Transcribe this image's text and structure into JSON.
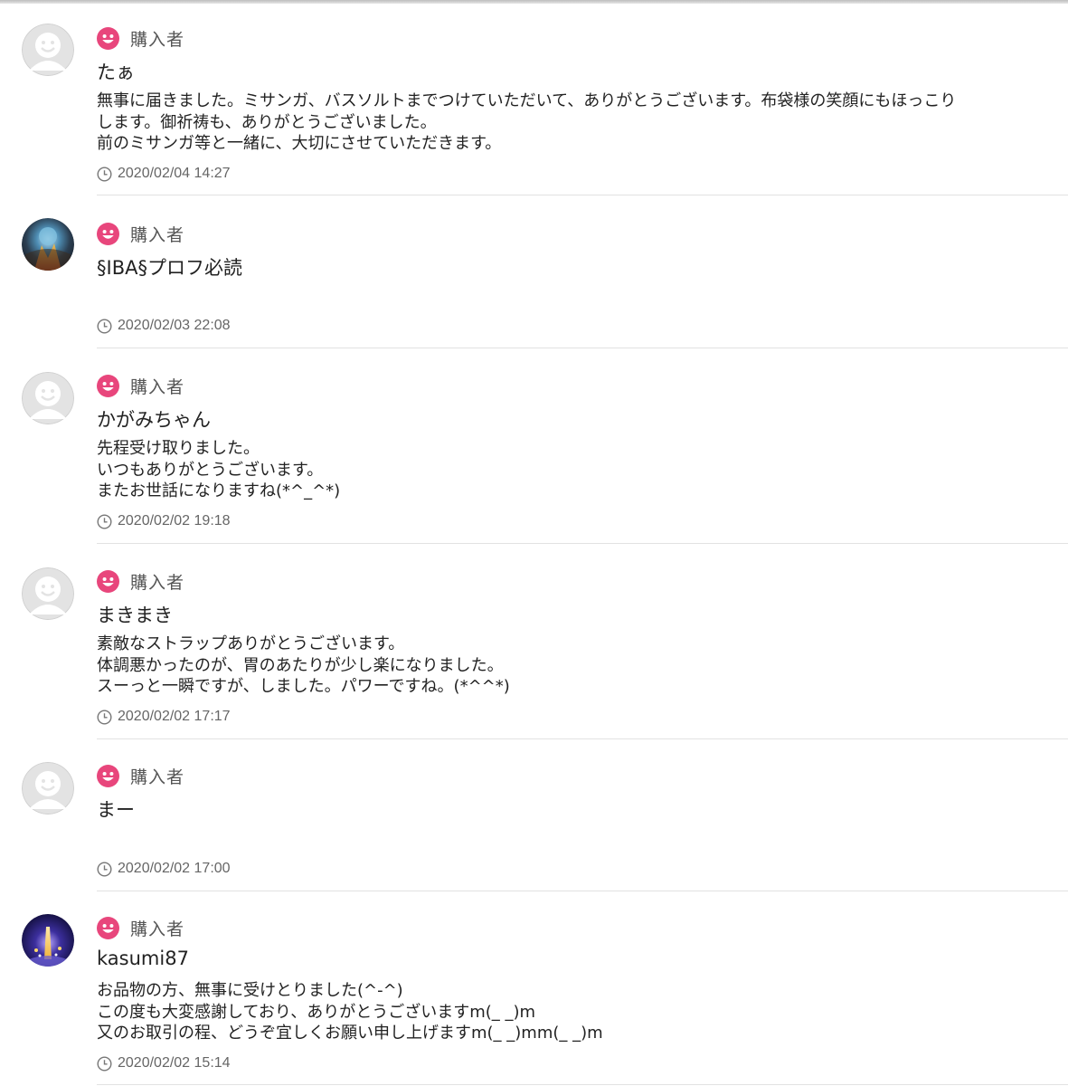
{
  "reviews": [
    {
      "role": "購入者",
      "username": "たぁ",
      "avatar": "default-avatar",
      "comment_lines": [
        "無事に届きました。ミサンガ、バスソルトまでつけていただいて、ありがとうございます。布袋様の笑顔にもほっこり",
        "します。御祈祷も、ありがとうございました。",
        "前のミサンガ等と一緒に、大切にさせていただきます。"
      ],
      "date": "2020/02/04 14:27"
    },
    {
      "role": "購入者",
      "username": "§IBA§プロフ必読",
      "avatar": "photo-avatar-earth",
      "comment_lines": [],
      "date": "2020/02/03 22:08"
    },
    {
      "role": "購入者",
      "username": "かがみちゃん",
      "avatar": "default-avatar",
      "comment_lines": [
        "先程受け取りました。",
        "いつもありがとうございます。",
        "またお世話になりますね(*^_^*)"
      ],
      "date": "2020/02/02 19:18"
    },
    {
      "role": "購入者",
      "username": "まきまき",
      "avatar": "default-avatar",
      "comment_lines": [
        "素敵なストラップありがとうございます。",
        "体調悪かったのが、胃のあたりが少し楽になりました。",
        "スーっと一瞬ですが、しました。パワーですね。(*^^*)"
      ],
      "date": "2020/02/02 17:17"
    },
    {
      "role": "購入者",
      "username": "まー",
      "avatar": "default-avatar",
      "comment_lines": [],
      "date": "2020/02/02 17:00"
    },
    {
      "role": "購入者",
      "username": "kasumi87",
      "avatar": "photo-avatar-night",
      "comment_lines": [
        "お品物の方、無事に受けとりました(^-^)",
        "この度も大変感謝しており、ありがとうございますm(_ _)m",
        "又のお取引の程、どうぞ宜しくお願い申し上げますm(_ _)mm(_ _)m"
      ],
      "date": "2020/02/02 15:14"
    }
  ],
  "icons": {
    "role_icon": "smile-face-icon",
    "date_icon": "clock-icon"
  },
  "colors": {
    "accent": "#e8467c",
    "divider": "#e2e2e2",
    "muted_text": "#666666"
  }
}
